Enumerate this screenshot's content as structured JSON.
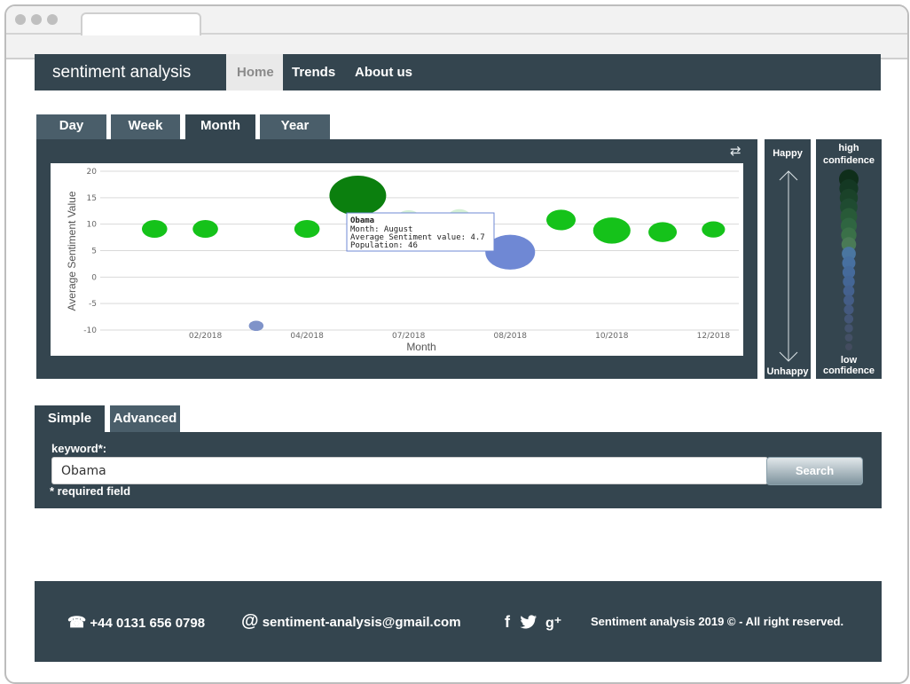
{
  "brand": "sentiment analysis",
  "nav": [
    {
      "label": "Home",
      "active": true
    },
    {
      "label": "Trends",
      "active": false
    },
    {
      "label": "About us",
      "active": false
    }
  ],
  "period_tabs": [
    {
      "label": "Day",
      "active": false
    },
    {
      "label": "Week",
      "active": false
    },
    {
      "label": "Month",
      "active": true
    },
    {
      "label": "Year",
      "active": false
    }
  ],
  "swap_icon": "⇄",
  "chart_data": {
    "type": "scatter",
    "ylabel": "Average Sentiment Value",
    "xlabel": "Month",
    "ylim": [
      -10,
      20
    ],
    "yticks": [
      -10,
      -5,
      0,
      5,
      10,
      15,
      20
    ],
    "xticks": [
      "02/2018",
      "04/2018",
      "07/2018",
      "08/2018",
      "10/2018",
      "12/2018"
    ],
    "grid": true,
    "points": [
      {
        "x": 1.0,
        "y": 9.1,
        "population": 12,
        "color": "#15c21a"
      },
      {
        "x": 2.0,
        "y": 9.1,
        "population": 12,
        "color": "#15c21a"
      },
      {
        "x": 3.0,
        "y": -9.2,
        "population": 4,
        "color": "#7f93c9"
      },
      {
        "x": 4.0,
        "y": 9.1,
        "population": 12,
        "color": "#15c21a"
      },
      {
        "x": 5.0,
        "y": 15.4,
        "population": 60,
        "color": "#0b7f0e"
      },
      {
        "x": 6.0,
        "y": 11.1,
        "population": 10,
        "color": "#d5f0d6"
      },
      {
        "x": 7.0,
        "y": 11.3,
        "population": 10,
        "color": "#d5f0d6"
      },
      {
        "x": 8.0,
        "y": 4.7,
        "population": 46,
        "color": "#6f88d4"
      },
      {
        "x": 9.0,
        "y": 10.8,
        "population": 16,
        "color": "#15c21a"
      },
      {
        "x": 10.0,
        "y": 8.8,
        "population": 26,
        "color": "#15c21a"
      },
      {
        "x": 11.0,
        "y": 8.5,
        "population": 15,
        "color": "#15c21a"
      },
      {
        "x": 12.0,
        "y": 9.0,
        "population": 10,
        "color": "#15c21a"
      }
    ],
    "tooltip": {
      "title": "Obama",
      "lines": [
        "Month: August",
        "Average Sentiment value: 4.7",
        "Population: 46"
      ]
    }
  },
  "legend_sentiment": {
    "top": "Happy",
    "bottom": "Unhappy"
  },
  "legend_confidence": {
    "top_line1": "high",
    "top_line2": "confidence",
    "bottom_line1": "low",
    "bottom_line2": "confidence",
    "colors": [
      "#0f2e1a",
      "#143823",
      "#1a4229",
      "#1f4b31",
      "#285a38",
      "#2f6541",
      "#3a7048",
      "#4a7a56",
      "#4a76a0",
      "#4770a0",
      "#456a9a",
      "#446695",
      "#44618e",
      "#445d86",
      "#44597e",
      "#445676",
      "#44536e",
      "#445066",
      "#434c5f"
    ]
  },
  "search_tabs": [
    {
      "label": "Simple",
      "active": true
    },
    {
      "label": "Advanced",
      "active": false
    }
  ],
  "search": {
    "keyword_label": "keyword*:",
    "value": "Obama",
    "button_label": "Search",
    "required_note": "* required field"
  },
  "footer": {
    "phone": "+44 0131 656 0798",
    "email": "sentiment-analysis@gmail.com",
    "social": [
      "facebook",
      "twitter",
      "google-plus"
    ],
    "copyright": "Sentiment analysis 2019 © - All right reserved."
  }
}
